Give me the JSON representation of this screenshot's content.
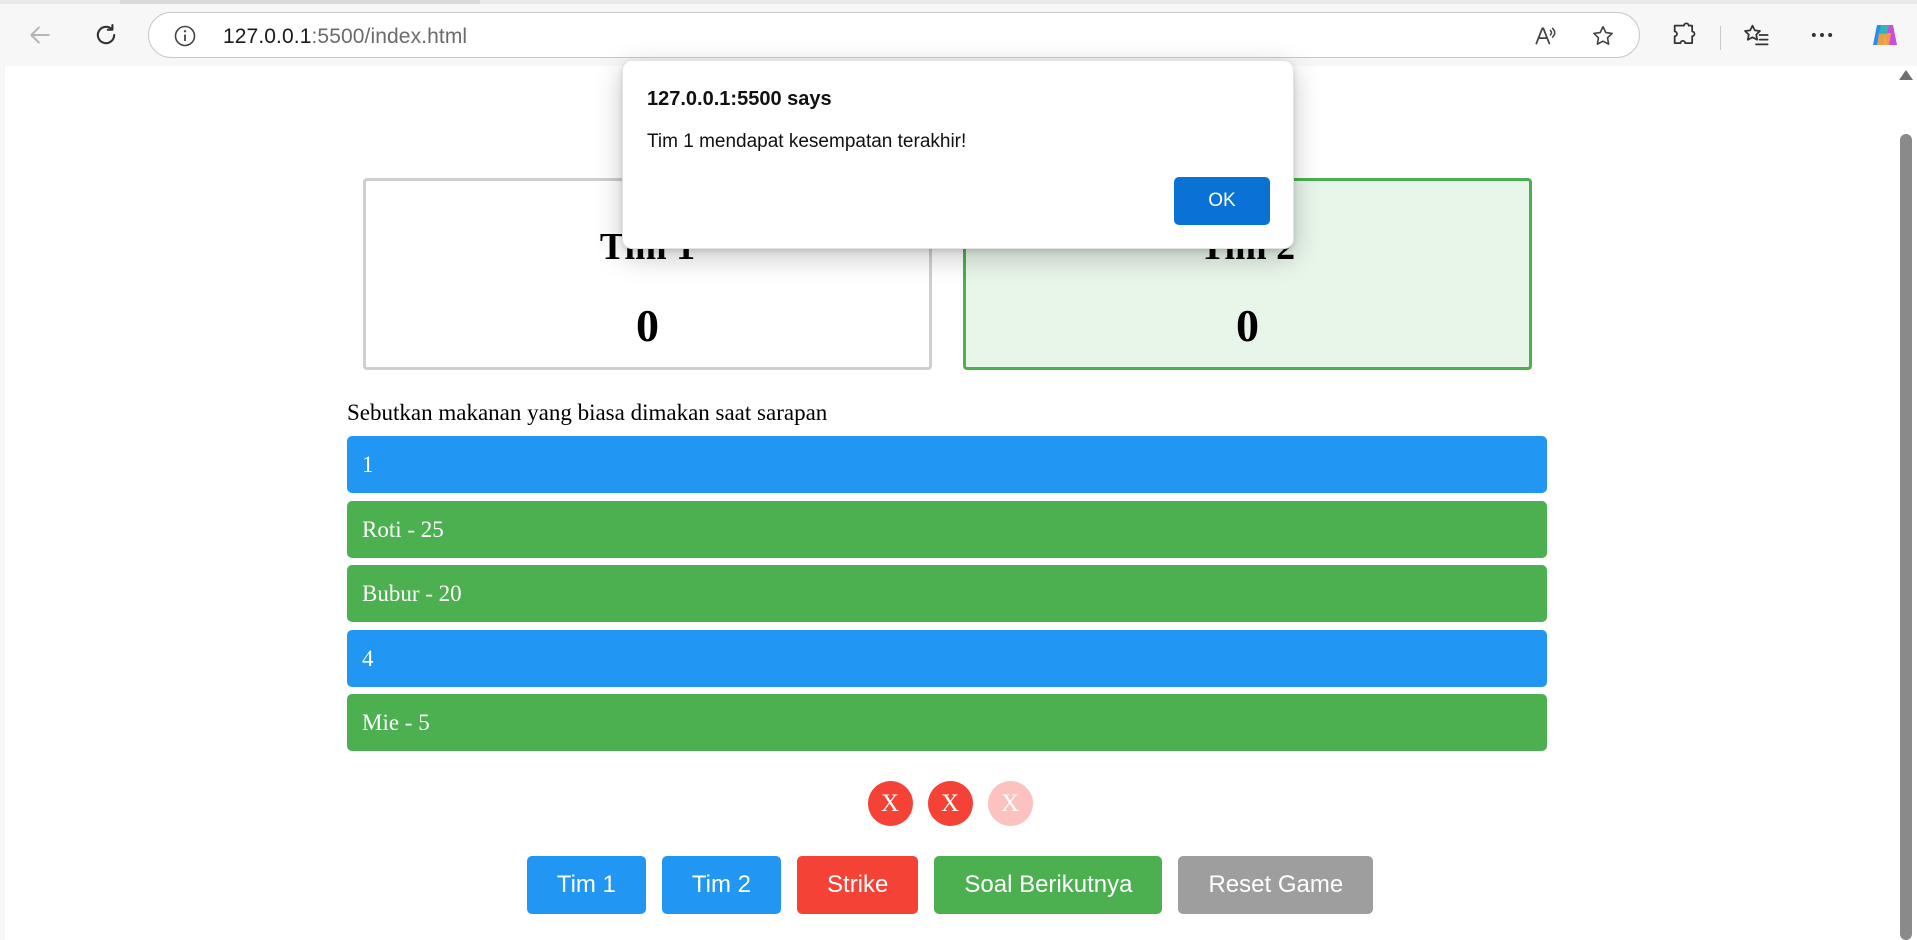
{
  "browser": {
    "url_host": "127.0.0.1",
    "url_rest": ":5500/index.html",
    "icons": [
      "back-icon",
      "reload-icon",
      "site-info-icon",
      "read-aloud-icon",
      "favorite-star-icon",
      "extensions-icon",
      "favorites-icon",
      "more-icon",
      "copilot-icon"
    ]
  },
  "scoreboard": {
    "team1": {
      "name": "Tim 1",
      "score": "0"
    },
    "team2": {
      "name": "Tim 2",
      "score": "0",
      "active": true
    }
  },
  "question": "Sebutkan makanan yang biasa dimakan saat sarapan",
  "answers": [
    {
      "text": "1",
      "revealed": false
    },
    {
      "text": "Roti - 25",
      "revealed": true
    },
    {
      "text": "Bubur - 20",
      "revealed": true
    },
    {
      "text": "4",
      "revealed": false
    },
    {
      "text": "Mie - 5",
      "revealed": true
    }
  ],
  "strikes": {
    "symbol": "X",
    "active_count": 2,
    "total": 3
  },
  "controls": {
    "tim1": "Tim 1",
    "tim2": "Tim 2",
    "strike": "Strike",
    "next": "Soal Berikutnya",
    "reset": "Reset Game"
  },
  "dialog": {
    "title": "127.0.0.1:5500 says",
    "message": "Tim 1 mendapat kesempatan terakhir!",
    "ok": "OK"
  },
  "colors": {
    "blue": "#2196f3",
    "green": "#4caf50",
    "red": "#f44336",
    "gray": "#9e9e9e",
    "ok_button": "#0b72d5"
  }
}
